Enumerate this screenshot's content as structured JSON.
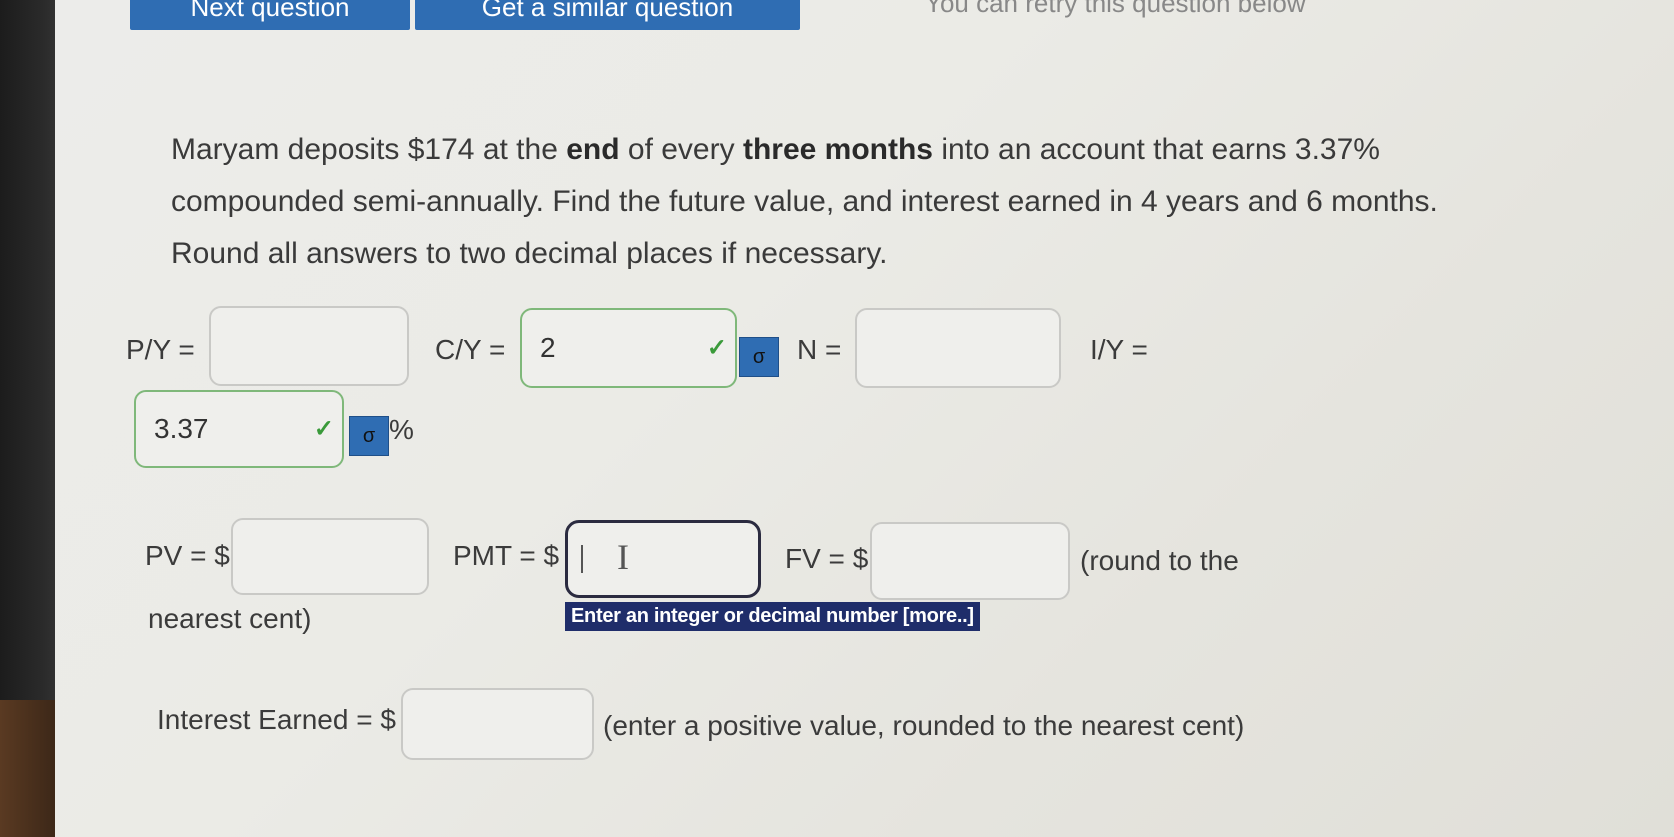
{
  "top_bar": {
    "next_question": "Next question",
    "similar_question": "Get a similar question",
    "retry_note": "You can retry this question below"
  },
  "question": {
    "p1": "Maryam deposits $174 at the ",
    "b1": "end",
    "p2": " of every ",
    "b2": "three months",
    "p3": " into an account that earns 3.37% compounded semi-annually. Find the future value, and interest earned in 4 years and 6 months. Round all answers to two decimal places if necessary."
  },
  "fields": {
    "py_label": "P/Y =",
    "py_value": "",
    "cy_label": "C/Y =",
    "cy_value": "2",
    "n_label": "N =",
    "n_value": "",
    "iy_label": "I/Y =",
    "iy_value": "3.37",
    "percent": "%",
    "pv_label": "PV = $",
    "pv_value": "",
    "pmt_label": "PMT = $",
    "pmt_value": "",
    "fv_label": "FV = $",
    "fv_value": "",
    "round_note_a": "(round to the",
    "round_note_b": "nearest cent)",
    "interest_label": "Interest Earned = $",
    "interest_value": "",
    "interest_note": "(enter a positive value, rounded to the nearest cent)"
  },
  "tooltip": "Enter an integer or decimal number [more..]",
  "icons": {
    "check": "✓",
    "tool": "σ"
  },
  "colors": {
    "accent": "#2f6db3",
    "correct_border": "#7fb87a",
    "tooltip_bg": "#1f2d6a"
  }
}
